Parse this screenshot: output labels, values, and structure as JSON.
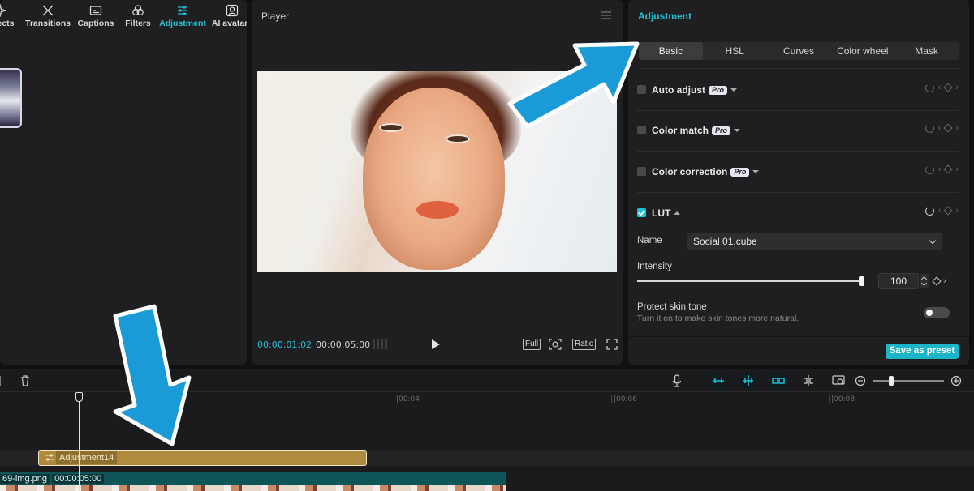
{
  "toolbar": {
    "items": [
      {
        "label": "Effects",
        "icon": "sparkle-icon"
      },
      {
        "label": "Transitions",
        "icon": "transition-icon"
      },
      {
        "label": "Captions",
        "icon": "captions-icon"
      },
      {
        "label": "Filters",
        "icon": "filters-icon"
      },
      {
        "label": "Adjustment",
        "icon": "sliders-icon",
        "active": true
      },
      {
        "label": "AI avatars",
        "icon": "avatar-icon"
      }
    ]
  },
  "player": {
    "title": "Player",
    "current_time": "00:00:01:02",
    "total_time": "00:00:05:00",
    "buttons": {
      "full": "Full",
      "ratio": "Ratio"
    }
  },
  "adjustment": {
    "title": "Adjustment",
    "tabs": [
      "Basic",
      "HSL",
      "Curves",
      "Color wheel",
      "Mask"
    ],
    "active_tab": "Basic",
    "pro_badge": "Pro",
    "sections": {
      "auto_adjust": "Auto adjust",
      "color_match": "Color match",
      "color_correction": "Color correction",
      "lut": "LUT"
    },
    "lut_enabled": true,
    "name_label": "Name",
    "name_value": "Social 01.cube",
    "intensity_label": "Intensity",
    "intensity_value": "100",
    "intensity_level": 1.0,
    "protect_title": "Protect skin tone",
    "protect_desc": "Turn it on to make skin tones more natural.",
    "protect_on": false,
    "save_preset": "Save as preset"
  },
  "timeline": {
    "ticks": [
      "|00:04",
      "|00:06",
      "|00:08"
    ],
    "adjustment_clip": "Adjustment14",
    "video_clip_name": "69-img.png",
    "video_clip_duration": "00:00:05:00"
  },
  "colors": {
    "accent": "#1ec0d5",
    "arrow": "#1a9ad6",
    "adjustment_clip": "#ae8a3c",
    "video_clip": "#0e5557"
  }
}
